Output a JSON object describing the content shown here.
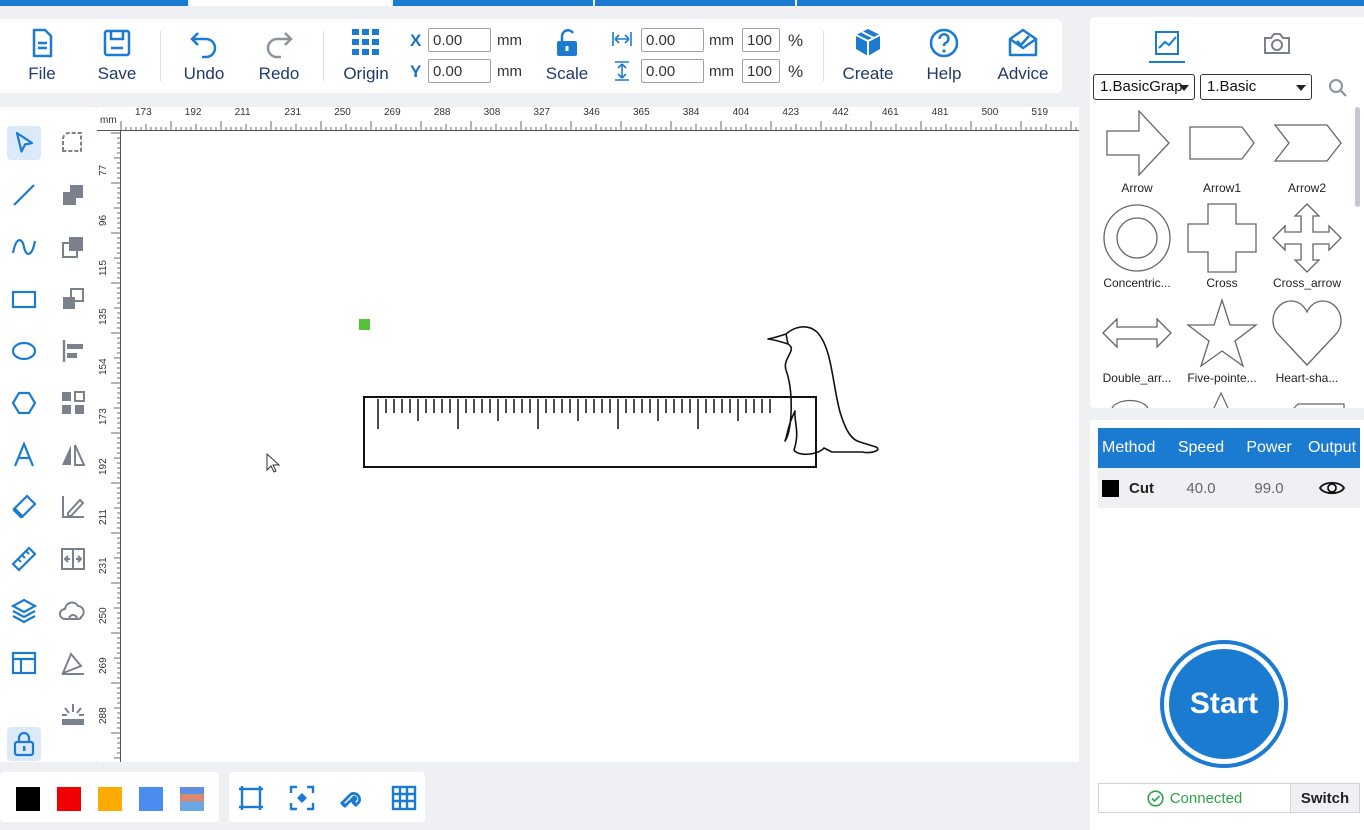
{
  "toolbar": {
    "file": "File",
    "save": "Save",
    "undo": "Undo",
    "redo": "Redo",
    "origin": "Origin",
    "x_label": "X",
    "y_label": "Y",
    "x_value": "0.00",
    "y_value": "0.00",
    "unit": "mm",
    "scale": "Scale",
    "width_value": "0.00",
    "height_value": "0.00",
    "width_percent": "100",
    "height_percent": "100",
    "percent_sign": "%",
    "create": "Create",
    "help": "Help",
    "advice": "Advice"
  },
  "ruler": {
    "unit": "mm",
    "top_ticks": [
      "173",
      "192",
      "211",
      "231",
      "250",
      "269",
      "288",
      "308",
      "327",
      "346",
      "365",
      "384",
      "404",
      "423",
      "442",
      "461",
      "481",
      "500",
      "519"
    ],
    "left_ticks": [
      "77",
      "96",
      "115",
      "135",
      "154",
      "173",
      "192",
      "211",
      "231",
      "250",
      "269",
      "288"
    ]
  },
  "left_tools": {
    "items": [
      "select-tool",
      "line-tool",
      "curve-tool",
      "rectangle-tool",
      "ellipse-tool",
      "polygon-tool",
      "text-tool",
      "eraser-tool",
      "measure-tool",
      "layers-tool",
      "layout-tool",
      "lock-tool"
    ],
    "secondary": [
      "corner-tool",
      "combine-tool",
      "copy-tool",
      "bring-forward-tool",
      "align-tool",
      "grid-tool",
      "mirror-tool",
      "edit-path-tool",
      "array-tool",
      "offset-tool",
      "vectorize-tool",
      "fill-tool"
    ]
  },
  "colors": [
    "#000000",
    "#f00000",
    "#ffaa00",
    "#4a8cf0"
  ],
  "right_panel": {
    "category_select": "1.BasicGrap",
    "subcategory_select": "1.Basic",
    "shapes": [
      "Arrow",
      "Arrow1",
      "Arrow2",
      "Concentric...",
      "Cross",
      "Cross_arrow",
      "Double_arr...",
      "Five-pointe...",
      "Heart-sha..."
    ]
  },
  "layers": {
    "headers": [
      "Method",
      "Speed",
      "Power",
      "Output"
    ],
    "rows": [
      {
        "color": "#000000",
        "method": "Cut",
        "speed": "40.0",
        "power": "99.0"
      }
    ]
  },
  "start_label": "Start",
  "status": {
    "connected": "Connected",
    "switch": "Switch"
  }
}
